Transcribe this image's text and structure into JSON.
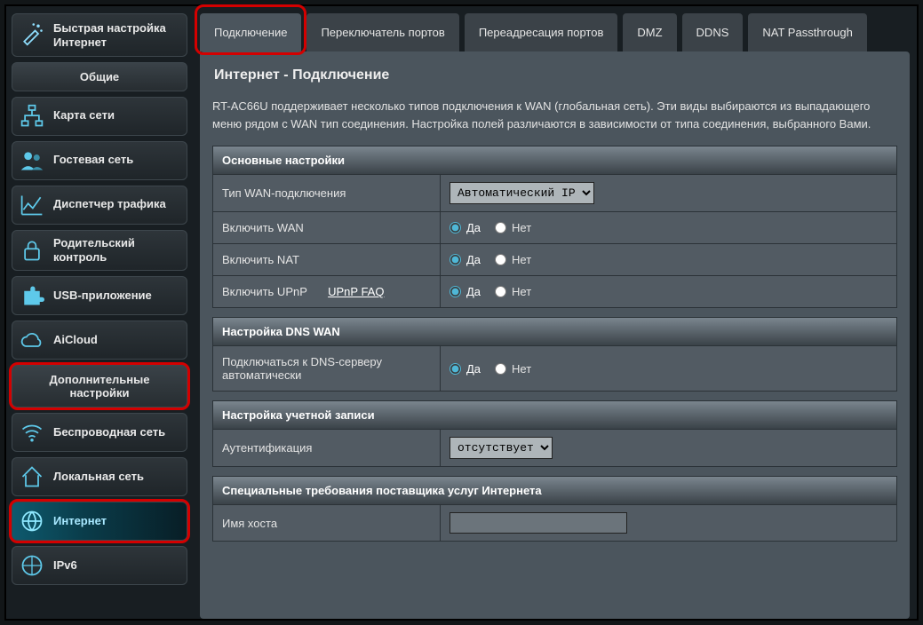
{
  "sidebar": {
    "quick_setup": "Быстрая настройка Интернет",
    "section_general": "Общие",
    "items_general": [
      {
        "label": "Карта сети"
      },
      {
        "label": "Гостевая сеть"
      },
      {
        "label": "Диспетчер трафика"
      },
      {
        "label": "Родительский контроль"
      },
      {
        "label": "USB-приложение"
      },
      {
        "label": "AiCloud"
      }
    ],
    "section_advanced": "Дополнительные настройки",
    "items_advanced": [
      {
        "label": "Беспроводная сеть"
      },
      {
        "label": "Локальная сеть"
      },
      {
        "label": "Интернет",
        "active": true
      },
      {
        "label": "IPv6"
      }
    ]
  },
  "tabs": [
    "Подключение",
    "Переключатель портов",
    "Переадресация портов",
    "DMZ",
    "DDNS",
    "NAT Passthrough"
  ],
  "page": {
    "title": "Интернет - Подключение",
    "desc": "RT-AC66U поддерживает несколько типов подключения к WAN (глобальная сеть). Эти виды выбираются из выпадающего меню рядом с WAN тип соединения. Настройка полей различаются в зависимости от типа соединения, выбранного Вами."
  },
  "sections": {
    "basic": {
      "head": "Основные настройки",
      "wan_type_label": "Тип WAN-подключения",
      "wan_type_value": "Автоматический IP",
      "enable_wan": "Включить WAN",
      "enable_nat": "Включить NAT",
      "enable_upnp": "Включить UPnP",
      "upnp_faq": "UPnP  FAQ"
    },
    "dns": {
      "head": "Настройка DNS WAN",
      "auto_dns": "Подключаться к DNS-серверу автоматически"
    },
    "account": {
      "head": "Настройка учетной записи",
      "auth_label": "Аутентификация",
      "auth_value": "отсутствует"
    },
    "special": {
      "head": "Специальные требования поставщика услуг Интернета",
      "host_label": "Имя хоста"
    }
  },
  "radio": {
    "yes": "Да",
    "no": "Нет"
  }
}
